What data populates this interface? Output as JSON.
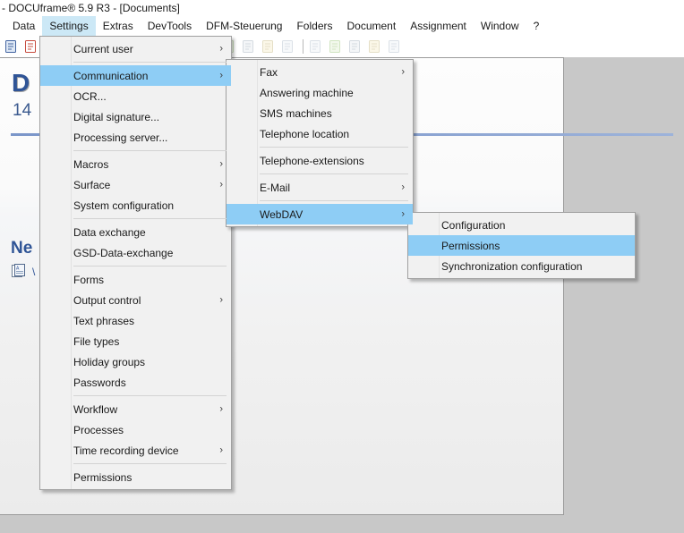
{
  "window": {
    "title": "- DOCUframe® 5.9 R3 - [Documents]"
  },
  "menubar": {
    "items": [
      {
        "label": "Data",
        "active": false
      },
      {
        "label": "Settings",
        "active": true
      },
      {
        "label": "Extras",
        "active": false
      },
      {
        "label": "DevTools",
        "active": false
      },
      {
        "label": "DFM-Steuerung",
        "active": false
      },
      {
        "label": "Folders",
        "active": false
      },
      {
        "label": "Document",
        "active": false
      },
      {
        "label": "Assignment",
        "active": false
      },
      {
        "label": "Window",
        "active": false
      },
      {
        "label": "?",
        "active": false
      }
    ]
  },
  "toolbar": {
    "icons": [
      "document-properties-icon",
      "calendar-icon",
      "copy-document-icon",
      "delete-document-icon",
      "glasses-icon",
      "assign-contact-icon",
      "new-contact-icon",
      "pin-icon",
      "address-card-icon",
      "folder-green-icon",
      "settings-gear-icon",
      "checklist-icon",
      "tag-icon",
      "address-card-delete-icon",
      "folder-green-delete-icon",
      "settings-gear-delete-icon",
      "checklist-delete-icon",
      "tag-delete-icon"
    ]
  },
  "document": {
    "big_letter": "D",
    "number": "14",
    "new_label": "Ne",
    "new_suffix": "\\"
  },
  "menus": {
    "settings": {
      "name": "Settings",
      "groups": [
        [
          {
            "label": "Current user",
            "submenu": true,
            "highlight": false
          }
        ],
        [
          {
            "label": "Communication",
            "submenu": true,
            "highlight": true
          },
          {
            "label": "OCR...",
            "submenu": false,
            "highlight": false
          },
          {
            "label": "Digital signature...",
            "submenu": false,
            "highlight": false
          },
          {
            "label": "Processing server...",
            "submenu": false,
            "highlight": false
          }
        ],
        [
          {
            "label": "Macros",
            "submenu": true,
            "highlight": false
          },
          {
            "label": "Surface",
            "submenu": true,
            "highlight": false
          },
          {
            "label": "System configuration",
            "submenu": false,
            "highlight": false
          }
        ],
        [
          {
            "label": "Data exchange",
            "submenu": false,
            "highlight": false
          },
          {
            "label": "GSD-Data-exchange",
            "submenu": false,
            "highlight": false
          }
        ],
        [
          {
            "label": "Forms",
            "submenu": false,
            "highlight": false
          },
          {
            "label": "Output control",
            "submenu": true,
            "highlight": false
          },
          {
            "label": "Text phrases",
            "submenu": false,
            "highlight": false
          },
          {
            "label": "File types",
            "submenu": false,
            "highlight": false
          },
          {
            "label": "Holiday groups",
            "submenu": false,
            "highlight": false
          },
          {
            "label": "Passwords",
            "submenu": false,
            "highlight": false
          }
        ],
        [
          {
            "label": "Workflow",
            "submenu": true,
            "highlight": false
          },
          {
            "label": "Processes",
            "submenu": false,
            "highlight": false
          },
          {
            "label": "Time recording device",
            "submenu": true,
            "highlight": false
          }
        ],
        [
          {
            "label": "Permissions",
            "submenu": false,
            "highlight": false
          }
        ]
      ]
    },
    "communication": {
      "name": "Communication",
      "groups": [
        [
          {
            "label": "Fax",
            "submenu": true,
            "highlight": false
          },
          {
            "label": "Answering machine",
            "submenu": false,
            "highlight": false
          },
          {
            "label": "SMS machines",
            "submenu": false,
            "highlight": false
          },
          {
            "label": "Telephone location",
            "submenu": false,
            "highlight": false
          }
        ],
        [
          {
            "label": "Telephone-extensions",
            "submenu": false,
            "highlight": false
          }
        ],
        [
          {
            "label": "E-Mail",
            "submenu": true,
            "highlight": false
          }
        ],
        [
          {
            "label": "WebDAV",
            "submenu": true,
            "highlight": true
          }
        ]
      ]
    },
    "webdav": {
      "name": "WebDAV",
      "groups": [
        [
          {
            "label": "Configuration",
            "submenu": false,
            "highlight": false
          },
          {
            "label": "Permissions",
            "submenu": false,
            "highlight": true
          },
          {
            "label": "Synchronization configuration",
            "submenu": false,
            "highlight": false
          }
        ]
      ]
    }
  },
  "colors": {
    "menu_highlight": "#8ecdf5",
    "menubar_active": "#cce8f6",
    "menu_bg": "#f1f1f1",
    "app_bg": "#c8c8c8",
    "accent_blue": "#2f5496"
  },
  "icons": {
    "submenu_arrow": "chevron-right-icon"
  }
}
